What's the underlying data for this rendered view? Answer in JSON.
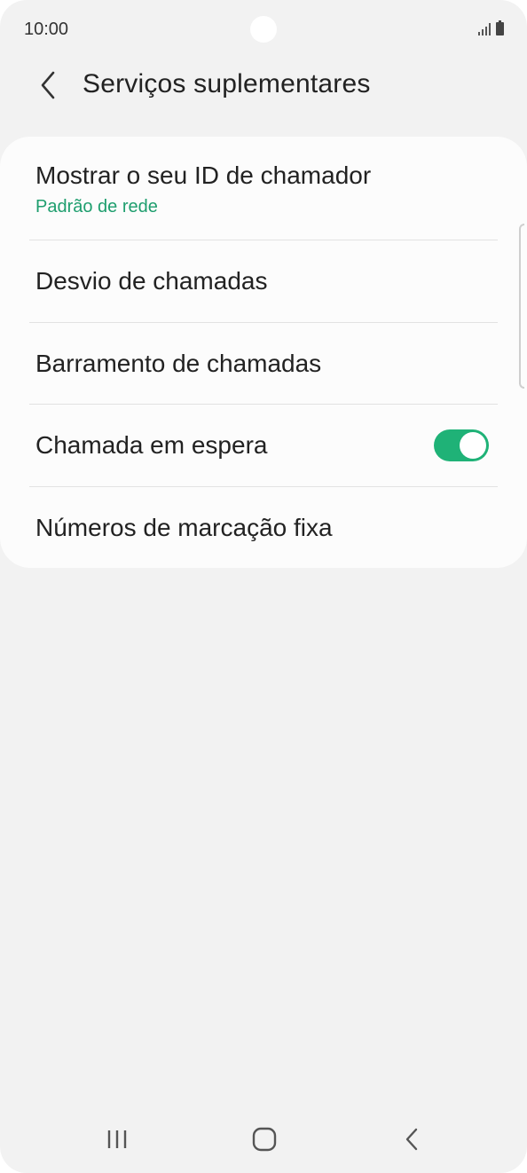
{
  "status_bar": {
    "time": "10:00",
    "icons": [
      "signal-icon",
      "battery-icon"
    ]
  },
  "header": {
    "back_icon": "chevron-left-icon",
    "title": "Serviços suplementares"
  },
  "settings": {
    "items": [
      {
        "label": "Mostrar o seu ID de chamador",
        "subtitle": "Padrão de rede"
      },
      {
        "label": "Desvio de chamadas"
      },
      {
        "label": "Barramento de chamadas"
      },
      {
        "label": "Chamada em espera",
        "toggle_on": true
      },
      {
        "label": "Números de marcação fixa"
      }
    ]
  },
  "nav_bar": {
    "icons": [
      "recent-apps-icon",
      "home-icon",
      "back-icon"
    ]
  },
  "colors": {
    "background": "#f2f2f2",
    "card": "#fcfcfc",
    "accent": "#1fb277",
    "subtitle": "#1e9e6e"
  }
}
